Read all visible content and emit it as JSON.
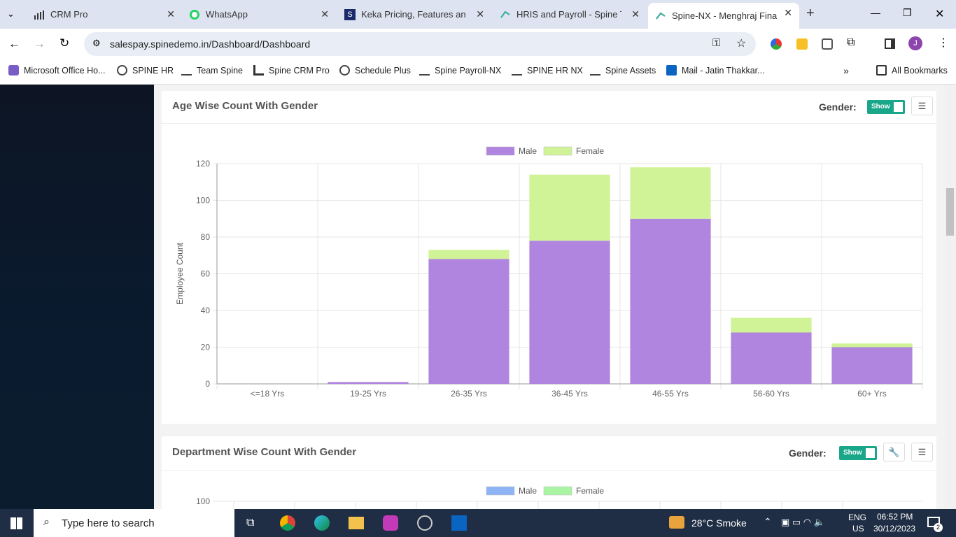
{
  "browser": {
    "tabs": [
      {
        "label": "CRM Pro"
      },
      {
        "label": "WhatsApp"
      },
      {
        "label": "Keka Pricing, Features and P"
      },
      {
        "label": "HRIS and Payroll - Spine Tec"
      },
      {
        "label": "Spine-NX - Menghraj Financ"
      }
    ],
    "url": "salespay.spinedemo.in/Dashboard/Dashboard",
    "bookmarks": [
      "Microsoft Office Ho...",
      "SPINE HR",
      "Team Spine",
      "Spine CRM Pro",
      "Schedule Plus",
      "Spine Payroll-NX",
      "SPINE HR NX",
      "Spine Assets",
      "Mail - Jatin Thakkar..."
    ],
    "all_bookmarks": "All Bookmarks",
    "profile_initial": "J"
  },
  "card1": {
    "title": "Age Wise Count With Gender",
    "gender_label": "Gender:",
    "toggle": "Show"
  },
  "card2": {
    "title": "Department Wise Count With Gender",
    "gender_label": "Gender:",
    "toggle": "Show"
  },
  "chart_data": [
    {
      "type": "bar",
      "stacked": true,
      "categories": [
        "<=18 Yrs",
        "19-25 Yrs",
        "26-35 Yrs",
        "36-45 Yrs",
        "46-55 Yrs",
        "56-60 Yrs",
        "60+ Yrs"
      ],
      "series": [
        {
          "name": "Male",
          "values": [
            0,
            1,
            68,
            78,
            90,
            28,
            20
          ],
          "color": "#b085e0"
        },
        {
          "name": "Female",
          "values": [
            0,
            0,
            5,
            36,
            28,
            8,
            2
          ],
          "color": "#d0f397"
        }
      ],
      "ylabel": "Employee Count",
      "ylim": [
        0,
        120
      ],
      "yticks": [
        0,
        20,
        40,
        60,
        80,
        100,
        120
      ],
      "legend": "top",
      "grid": true
    },
    {
      "type": "bar",
      "stacked": true,
      "series": [
        {
          "name": "Male",
          "color": "#8fb4f5"
        },
        {
          "name": "Female",
          "color": "#a9f5a3"
        }
      ],
      "yticks": [
        100
      ],
      "legend": "top"
    }
  ],
  "taskbar": {
    "search": "Type here to search",
    "weather": "28°C Smoke",
    "lang1": "ENG",
    "lang2": "US",
    "time": "06:52 PM",
    "date": "30/12/2023",
    "notif": "2"
  }
}
